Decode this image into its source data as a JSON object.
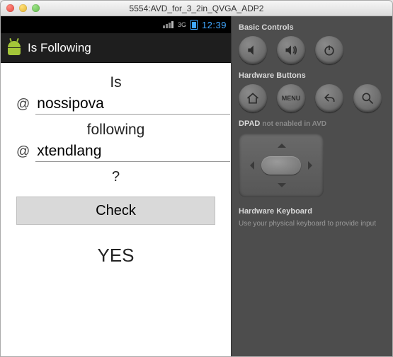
{
  "window": {
    "title": "5554:AVD_for_3_2in_QVGA_ADP2"
  },
  "statusbar": {
    "net": "3G",
    "time": "12:39"
  },
  "appbar": {
    "title": "Is Following"
  },
  "form": {
    "is_label": "Is",
    "at1": "@",
    "user1": "nossipova",
    "following_label": "following",
    "at2": "@",
    "user2": "xtendlang",
    "qmark": "?",
    "check_label": "Check",
    "result": "YES"
  },
  "side": {
    "basic_label": "Basic Controls",
    "hardware_label": "Hardware Buttons",
    "menu_label": "MENU",
    "dpad_label": "DPAD",
    "dpad_note": "not enabled in AVD",
    "hk_label": "Hardware Keyboard",
    "hk_note": "Use your physical keyboard to provide input"
  }
}
